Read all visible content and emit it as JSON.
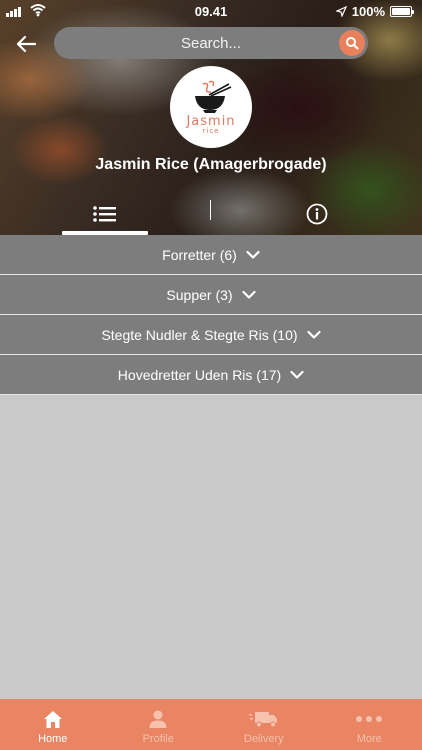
{
  "status_bar": {
    "time": "09.41",
    "battery": "100%"
  },
  "search": {
    "placeholder": "Search..."
  },
  "restaurant": {
    "name": "Jasmin Rice (Amagerbrogade)",
    "logo_text": "Jasmin",
    "logo_subtext": "rice"
  },
  "tabs": [
    {
      "icon": "list-icon",
      "active": true
    },
    {
      "icon": "info-icon",
      "active": false
    }
  ],
  "categories": [
    {
      "label": "Forretter (6)"
    },
    {
      "label": "Supper (3)"
    },
    {
      "label": "Stegte Nudler & Stegte Ris (10)"
    },
    {
      "label": "Hovedretter Uden Ris (17)"
    }
  ],
  "bottom_nav": [
    {
      "label": "Home",
      "icon": "home-icon",
      "active": true
    },
    {
      "label": "Profile",
      "icon": "profile-icon",
      "active": false
    },
    {
      "label": "Delivery",
      "icon": "delivery-truck-icon",
      "active": false
    },
    {
      "label": "More",
      "icon": "more-dots-icon",
      "active": false
    }
  ],
  "colors": {
    "accent": "#ea8563",
    "category_bg": "#7d7d7d",
    "page_bg": "#c9c9c9",
    "logo_text": "#e07a5f"
  }
}
